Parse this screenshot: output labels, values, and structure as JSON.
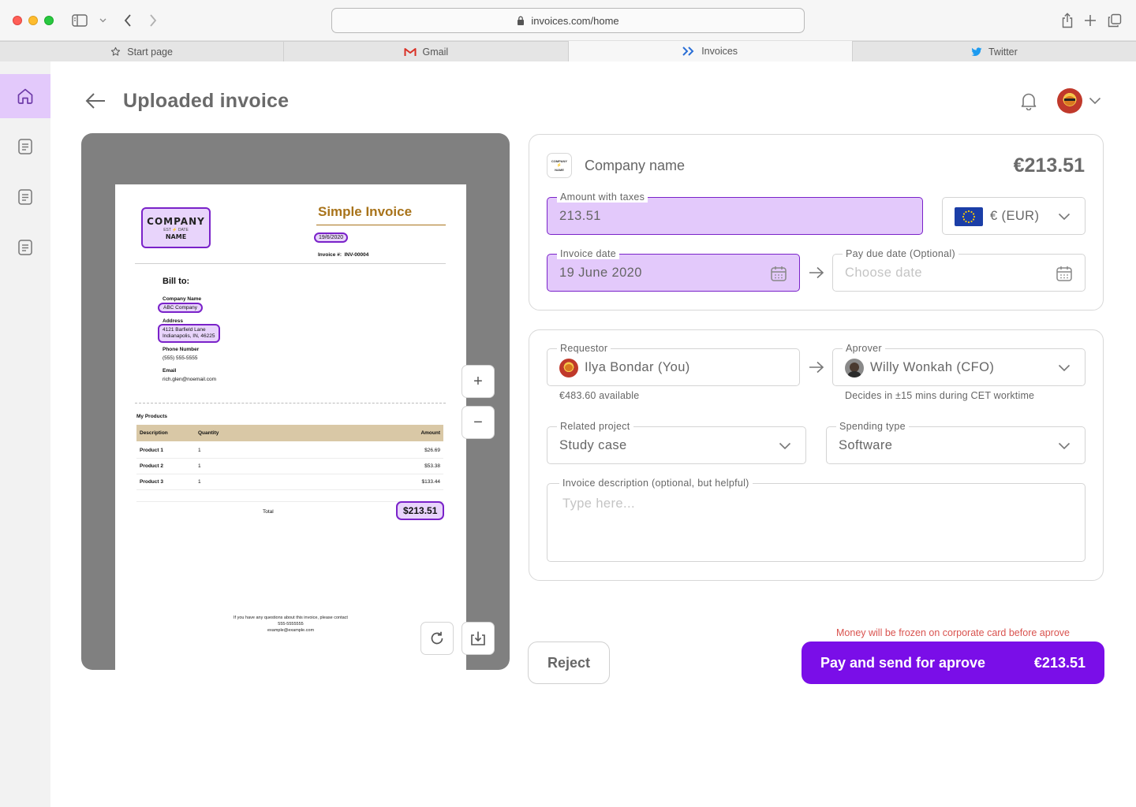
{
  "browser": {
    "url": "invoices.com/home",
    "tabs": [
      {
        "label": "Start page",
        "icon": "star-icon"
      },
      {
        "label": "Gmail",
        "icon": "gmail-icon"
      },
      {
        "label": "Invoices",
        "icon": "invoices-icon"
      },
      {
        "label": "Twitter",
        "icon": "twitter-icon"
      }
    ],
    "active_tab": "Invoices"
  },
  "sidebar": {
    "items": [
      {
        "name": "home",
        "icon": "home-icon",
        "active": true
      },
      {
        "name": "documents-1",
        "icon": "document-icon"
      },
      {
        "name": "documents-2",
        "icon": "document-icon"
      },
      {
        "name": "documents-3",
        "icon": "document-icon"
      }
    ]
  },
  "header": {
    "title": "Uploaded invoice"
  },
  "invoice_document": {
    "logo_top": "COMPANY",
    "logo_small_left": "EST",
    "logo_small_right": "DATE",
    "logo_bottom": "NAME",
    "title": "Simple Invoice",
    "date": "19/6/2020",
    "invoice_number_label": "Invoice #:",
    "invoice_number": "INV-00004",
    "bill_to": "Bill to:",
    "company_name_label": "Company Name",
    "company_name": "ABC Company",
    "address_label": "Address",
    "address_line1": "4121 Barfield Lane",
    "address_line2": "Indianapolis, IN, 46225",
    "phone_label": "Phone Number",
    "phone": "(555) 555-5555",
    "email_label": "Email",
    "email": "rich.glen@noemail.com",
    "products_title": "My Products",
    "columns": [
      "Description",
      "Quantity",
      "Amount"
    ],
    "rows": [
      [
        "Product 1",
        "1",
        "$26.69"
      ],
      [
        "Product 2",
        "1",
        "$53.38"
      ],
      [
        "Product 3",
        "1",
        "$133.44"
      ]
    ],
    "total_label": "Total",
    "total_value": "$213.51",
    "footer_line1": "If you have any questions about this invoice, please contact",
    "footer_line2": "555-5555555",
    "footer_line3": "example@example.com"
  },
  "preview_controls": {
    "zoom_in": "+",
    "zoom_out": "−"
  },
  "summary": {
    "company_logo_top": "COMPANY",
    "company_logo_bottom": "NAME",
    "company_name": "Company name",
    "amount": "€213.51"
  },
  "form": {
    "amount_label": "Amount with taxes",
    "amount_value": "213.51",
    "currency_value": "€ (EUR)",
    "invoice_date_label": "Invoice date",
    "invoice_date_value": "19 June 2020",
    "due_date_label": "Pay due date (Optional)",
    "due_date_placeholder": "Choose date",
    "requestor_label": "Requestor",
    "requestor_value": "Ilya Bondar (You)",
    "requestor_caption": "€483.60 available",
    "approver_label": "Aprover",
    "approver_value": "Willy Wonkah (CFO)",
    "approver_caption": "Decides in ±15 mins during CET worktime",
    "project_label": "Related project",
    "project_value": "Study case",
    "spending_label": "Spending type",
    "spending_value": "Software",
    "description_label": "Invoice description (optional, but helpful)",
    "description_placeholder": "Type here..."
  },
  "actions": {
    "frozen_note": "Money will be frozen on corporate card before aprove",
    "reject_label": "Reject",
    "pay_label": "Pay and send for aprove",
    "pay_amount": "€213.51"
  },
  "colors": {
    "accent": "#7a0ee8",
    "highlight_fill": "#e3c9fb",
    "warning_text": "#d9534f",
    "invoice_title": "#a8731a"
  }
}
